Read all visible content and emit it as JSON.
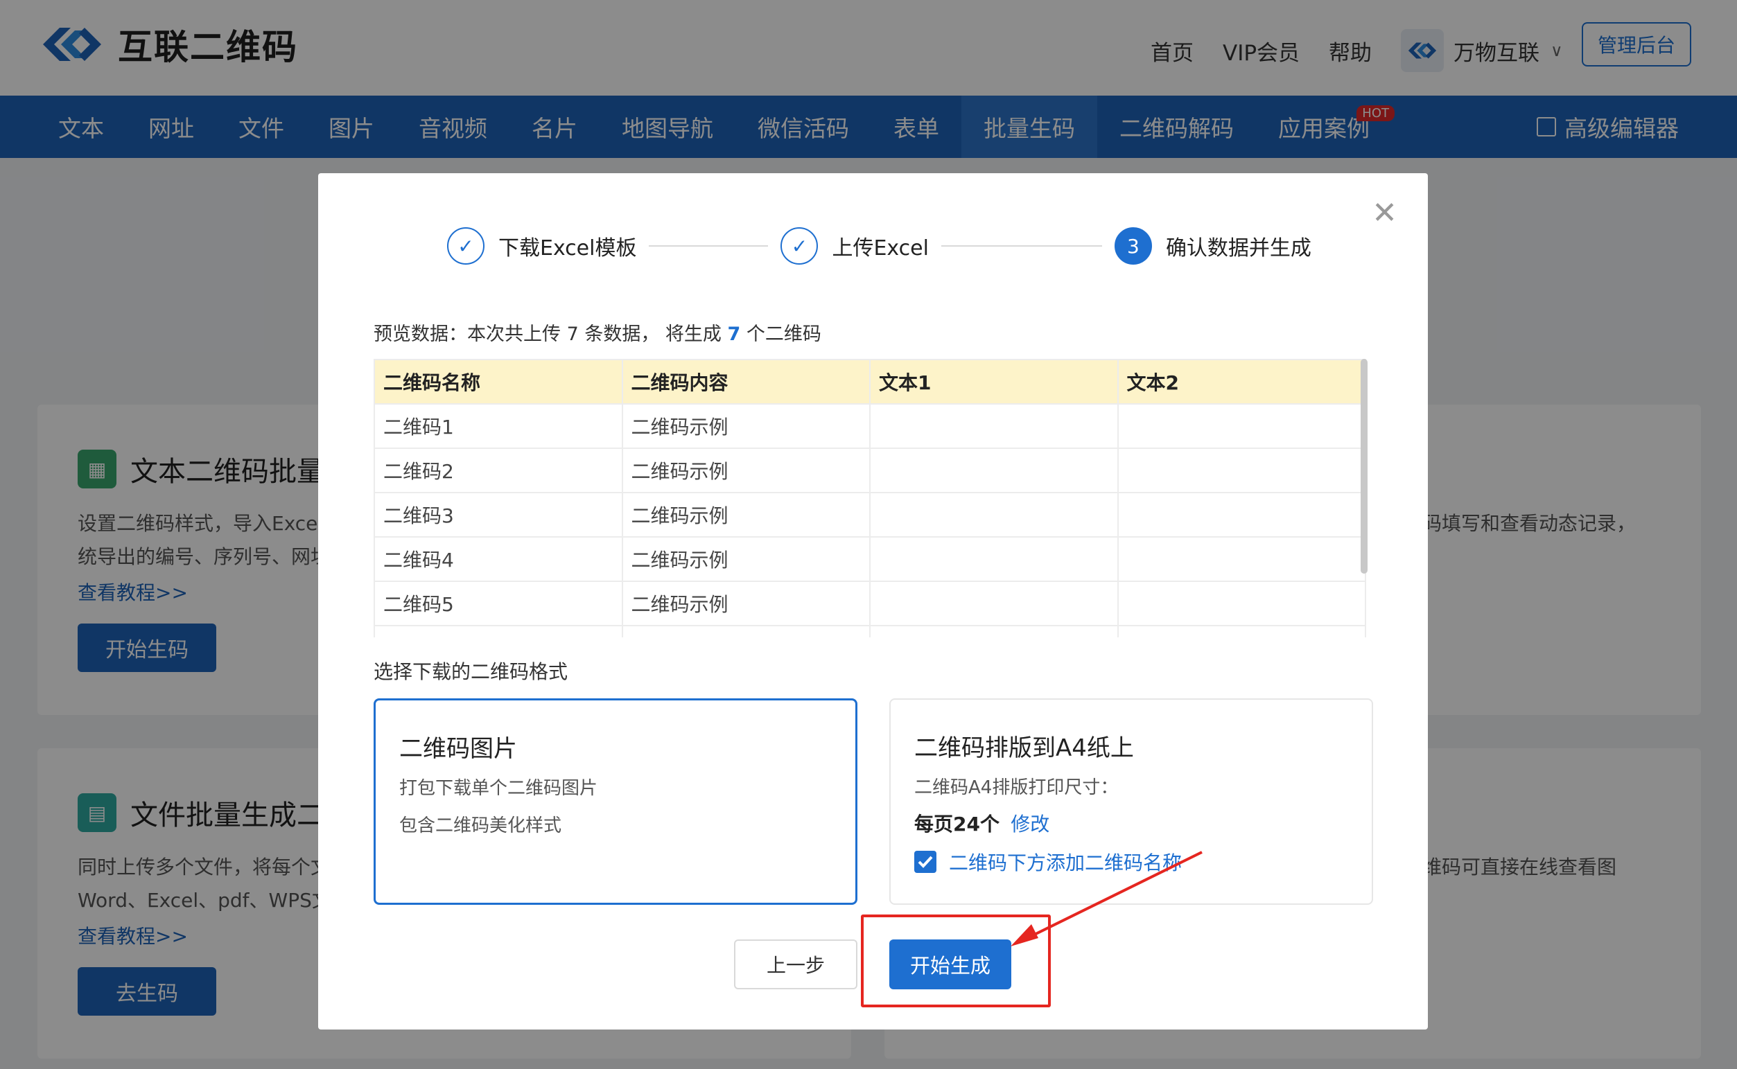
{
  "header": {
    "logo_text": "互联二维码",
    "topnav": [
      "首页",
      "VIP会员",
      "帮助"
    ],
    "org_name": "万物互联",
    "admin_label": "管理后台"
  },
  "mainnav": {
    "items": [
      "文本",
      "网址",
      "文件",
      "图片",
      "音视频",
      "名片",
      "地图导航",
      "微信活码",
      "表单",
      "批量生码",
      "二维码解码",
      "应用案例"
    ],
    "active": "批量生码",
    "hot_badge": "HOT",
    "advanced_editor": "高级编辑器"
  },
  "background": {
    "card1": {
      "title": "文本二维码批量",
      "desc_line1": "设置二维码样式，导入Excel",
      "desc_line2": "统导出的编号、序列号、网址",
      "link": "查看教程>>",
      "button": "开始生码"
    },
    "card2": {
      "title": "文件批量生成二",
      "desc_line1": "同时上传多个文件，将每个文",
      "desc_line2": "Word、Excel、pdf、WPS文",
      "link": "查看教程>>",
      "button": "去生码"
    },
    "right_card1_text": "码填写和查看动态记录，",
    "right_card2_text": "维码可直接在线查看图"
  },
  "modal": {
    "steps": [
      {
        "label": "下载Excel模板",
        "state": "done"
      },
      {
        "label": "上传Excel",
        "state": "done"
      },
      {
        "label": "确认数据并生成",
        "number": "3",
        "state": "current"
      }
    ],
    "preview_prefix": "预览数据：本次共上传 7 条数据， 将生成",
    "preview_count": "7",
    "preview_suffix": "个二维码",
    "table": {
      "headers": [
        "二维码名称",
        "二维码内容",
        "文本1",
        "文本2"
      ],
      "rows": [
        [
          "二维码1",
          "二维码示例",
          "",
          ""
        ],
        [
          "二维码2",
          "二维码示例",
          "",
          ""
        ],
        [
          "二维码3",
          "二维码示例",
          "",
          ""
        ],
        [
          "二维码4",
          "二维码示例",
          "",
          ""
        ],
        [
          "二维码5",
          "二维码示例",
          "",
          ""
        ]
      ]
    },
    "format_label": "选择下载的二维码格式",
    "option_image": {
      "title": "二维码图片",
      "line1": "打包下载单个二维码图片",
      "line2": "包含二维码美化样式"
    },
    "option_a4": {
      "title": "二维码排版到A4纸上",
      "line1": "二维码A4排版打印尺寸：",
      "per_page": "每页24个",
      "modify": "修改",
      "checkbox_label": "二维码下方添加二维码名称"
    },
    "prev_button": "上一步",
    "start_button": "开始生成"
  },
  "colors": {
    "brand_blue": "#1e63b8",
    "accent_blue": "#1e6fd0",
    "annotation_red": "#e52620",
    "table_header": "#fdf3c9"
  }
}
